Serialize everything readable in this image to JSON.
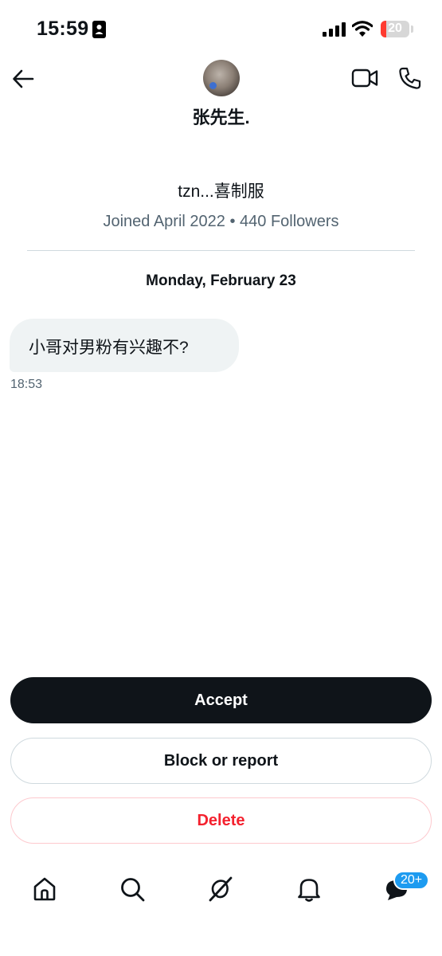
{
  "status_bar": {
    "time": "15:59",
    "battery_level": "20",
    "battery_fraction": 0.2
  },
  "header": {
    "contact_name": "张先生."
  },
  "profile": {
    "bio": "tzn...喜制服",
    "meta": "Joined April 2022 • 440 Followers"
  },
  "conversation": {
    "date": "Monday, February 23",
    "messages": [
      {
        "text": "小哥对男粉有兴趣不?",
        "time": "18:53"
      }
    ]
  },
  "actions": {
    "accept_label": "Accept",
    "block_report_label": "Block or report",
    "delete_label": "Delete"
  },
  "tab_bar": {
    "tabs": [
      {
        "icon": "home-icon"
      },
      {
        "icon": "search-icon"
      },
      {
        "icon": "grok-icon"
      },
      {
        "icon": "bell-icon"
      },
      {
        "icon": "messages-icon"
      }
    ],
    "messages_badge": "20+"
  },
  "colors": {
    "accept_bg": "#0f1419",
    "delete_text": "#f4212e",
    "badge": "#1d9bf0",
    "battery_low": "#ff3b30",
    "muted_text": "#536471"
  }
}
